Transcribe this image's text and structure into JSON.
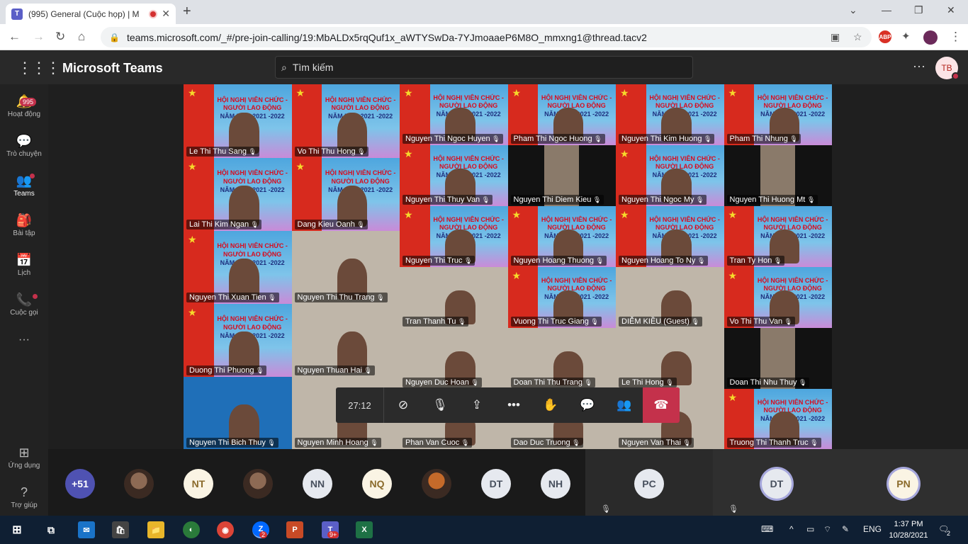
{
  "browser": {
    "tab_title": "(995) General (Cuộc họp) | M",
    "url": "teams.microsoft.com/_#/pre-join-calling/19:MbALDx5rqQuf1x_aWTYSwDa-7YJmoaaeP6M8O_mmxng1@thread.tacv2",
    "window_controls": [
      "minimize-icon",
      "maximize-icon",
      "close-icon"
    ],
    "extension_labels": [
      "ABP"
    ]
  },
  "header": {
    "app_name": "Microsoft Teams",
    "search_placeholder": "Tìm kiếm",
    "user_initials": "TB"
  },
  "rail": {
    "activity_badge": "995",
    "items": [
      {
        "label": "Hoạt động",
        "icon": "bell-icon"
      },
      {
        "label": "Trò chuyện",
        "icon": "chat-icon"
      },
      {
        "label": "Teams",
        "icon": "teams-icon"
      },
      {
        "label": "Bài tập",
        "icon": "assignments-icon"
      },
      {
        "label": "Lịch",
        "icon": "calendar-icon"
      },
      {
        "label": "Cuộc gọi",
        "icon": "phone-icon"
      }
    ],
    "more": "···",
    "bottom": [
      {
        "label": "Ứng dụng",
        "icon": "apps-icon"
      },
      {
        "label": "Trợ giúp",
        "icon": "help-icon"
      }
    ]
  },
  "banner": {
    "line1": "HỘI NGHỊ VIÊN CHỨC - NGƯỜI LAO ĐỘNG",
    "line2": "NĂM HỌC 2021 -2022"
  },
  "participants": [
    "Le Thi Thu Sang",
    "Vo Thi Thu Hong",
    "Nguyen Thi Ngoc Huyen",
    "Pham Thi Ngoc Huong",
    "Nguyen Thi Kim Huong",
    "Pham Thi Nhung",
    "Nguyen Thi Thuy Van",
    "Nguyen Thi Diem Kieu",
    "Nguyen Thi Ngoc My",
    "Nguyen Thi Huong Mt",
    "Lai Thi Kim Ngan",
    "Dang Kieu Oanh",
    "Nguyen Thi Truc",
    "Nguyen Hoang Thuong",
    "Nguyen Hoang To Ny",
    "Tran Ty Hon",
    "Nguyen Thi Xuan Tien",
    "Nguyen Thi Thu Trang",
    "Tran Thanh Tu",
    "Vuong Thi Truc Giang",
    "DIỄM KIỀU (Guest)",
    "Vo Thi Thu Van",
    "Duong Thi Phuong",
    "Nguyen Thuan Hai",
    "Nguyen Duc Hoan",
    "Doan Thi Thu Trang",
    "Le Thi Hong",
    "Doan Thi Nhu Thuy",
    "Nguyen Thi Bich Thuy",
    "Nguyen Minh Hoang",
    "Phan Van Cuoc",
    "Dao Duc Truong",
    "Nguyen Van Thai",
    "Truong Thi Thanh Truc"
  ],
  "call_bar": {
    "duration": "27:12",
    "buttons": [
      "camera-off-icon",
      "mic-off-icon",
      "share-screen-icon",
      "more-options-icon",
      "raise-hand-icon",
      "chat-icon",
      "participants-icon",
      "hang-up-icon"
    ]
  },
  "strip": {
    "more_count": "+51",
    "avatars": [
      "",
      "NT",
      "",
      "NN",
      "NQ",
      "",
      "DT",
      "NH"
    ],
    "speakers": [
      "PC",
      "DT",
      "PN"
    ]
  },
  "taskbar": {
    "apps": [
      "windows-start-icon",
      "task-view-icon",
      "mail-icon",
      "store-icon",
      "file-explorer-icon",
      "unknown-app-icon",
      "chrome-icon",
      "zalo-icon",
      "powerpoint-icon",
      "teams-icon",
      "excel-icon"
    ],
    "zalo_badge": "2",
    "teams_badge": "9+",
    "language": "ENG",
    "time": "1:37 PM",
    "date": "10/28/2021",
    "notifications": "2"
  }
}
